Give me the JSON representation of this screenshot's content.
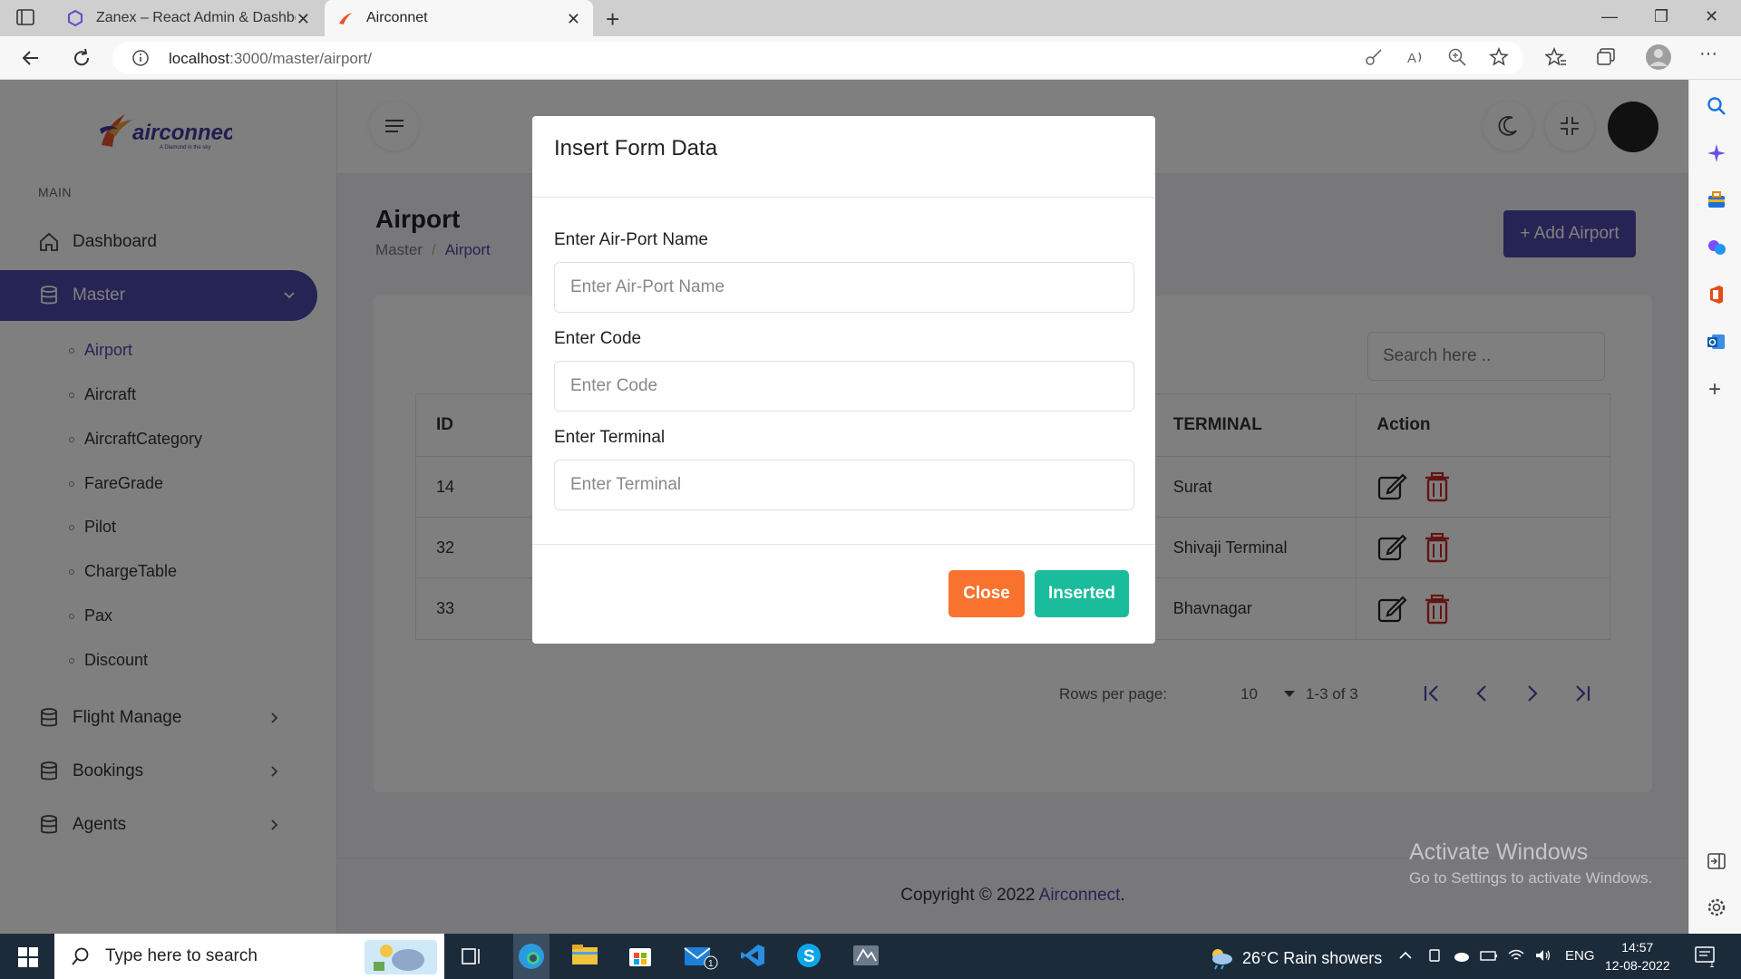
{
  "browser": {
    "tabs": [
      {
        "title": "Zanex – React Admin & Dashboa",
        "active": false
      },
      {
        "title": "Airconnet",
        "active": true
      }
    ],
    "url_host": "localhost",
    "url_path": ":3000/master/airport/"
  },
  "sidebar": {
    "brand": "airconnect",
    "brand_tagline": "A Diamond in the sky",
    "section": "MAIN",
    "items": [
      {
        "label": "Dashboard"
      },
      {
        "label": "Master"
      },
      {
        "label": "Flight Manage"
      },
      {
        "label": "Bookings"
      },
      {
        "label": "Agents"
      }
    ],
    "master_sub": [
      "Airport",
      "Aircraft",
      "AircraftCategory",
      "FareGrade",
      "Pilot",
      "ChargeTable",
      "Pax",
      "Discount"
    ]
  },
  "page": {
    "title": "Airport",
    "breadcrumb": [
      "Master",
      "Airport"
    ],
    "add_button": "+ Add Airport",
    "search_placeholder": "Search here .."
  },
  "table": {
    "headers": {
      "id": "ID",
      "terminal": "TERMINAL",
      "action": "Action"
    },
    "rows": [
      {
        "id": "14",
        "terminal": "Surat"
      },
      {
        "id": "32",
        "terminal": "Shivaji Terminal"
      },
      {
        "id": "33",
        "terminal": "Bhavnagar"
      }
    ]
  },
  "pager": {
    "rows_label": "Rows per page:",
    "rows_value": "10",
    "range": "1-3 of 3"
  },
  "footer": {
    "text": "Copyright © 2022 ",
    "brand": "Airconnect",
    "end": "."
  },
  "modal": {
    "title": "Insert Form Data",
    "fields": [
      {
        "label": "Enter Air-Port Name",
        "placeholder": "Enter Air-Port Name"
      },
      {
        "label": "Enter Code",
        "placeholder": "Enter Code"
      },
      {
        "label": "Enter Terminal",
        "placeholder": "Enter Terminal"
      }
    ],
    "close_label": "Close",
    "submit_label": "Inserted"
  },
  "watermark": {
    "line1": "Activate Windows",
    "line2": "Go to Settings to activate Windows."
  },
  "taskbar": {
    "search_placeholder": "Type here to search",
    "weather": "26°C  Rain showers",
    "language": "ENG",
    "time": "14:57",
    "date": "12-08-2022",
    "mail_badge": "1",
    "notification_badge": "1"
  },
  "colors": {
    "primary": "#4c48a8",
    "close_button": "#f9722e",
    "submit_button": "#1bbc9b",
    "delete_icon": "#c62828"
  }
}
